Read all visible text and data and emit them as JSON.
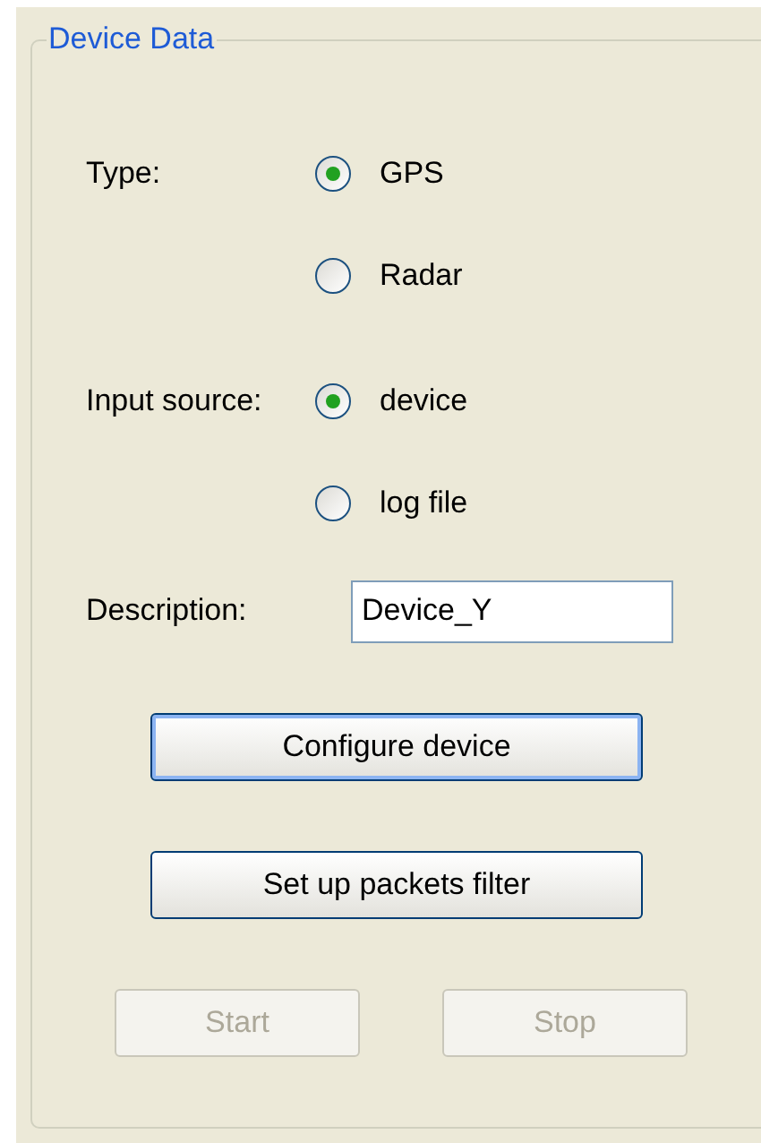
{
  "group": {
    "title": "Device Data"
  },
  "radio_groups": [
    {
      "label": "Type:",
      "options": [
        {
          "label": "GPS",
          "selected": true
        },
        {
          "label": "Radar",
          "selected": false
        }
      ]
    },
    {
      "label": "Input source:",
      "options": [
        {
          "label": "device",
          "selected": true
        },
        {
          "label": "log file",
          "selected": false
        }
      ]
    }
  ],
  "description": {
    "label": "Description:",
    "value": "Device_Y"
  },
  "buttons": [
    {
      "label": "Configure device",
      "disabled": false,
      "focused": true
    },
    {
      "label": "Set up packets filter",
      "disabled": false,
      "focused": false
    }
  ],
  "run_buttons": [
    {
      "label": "Start",
      "disabled": true
    },
    {
      "label": "Stop",
      "disabled": true
    }
  ]
}
